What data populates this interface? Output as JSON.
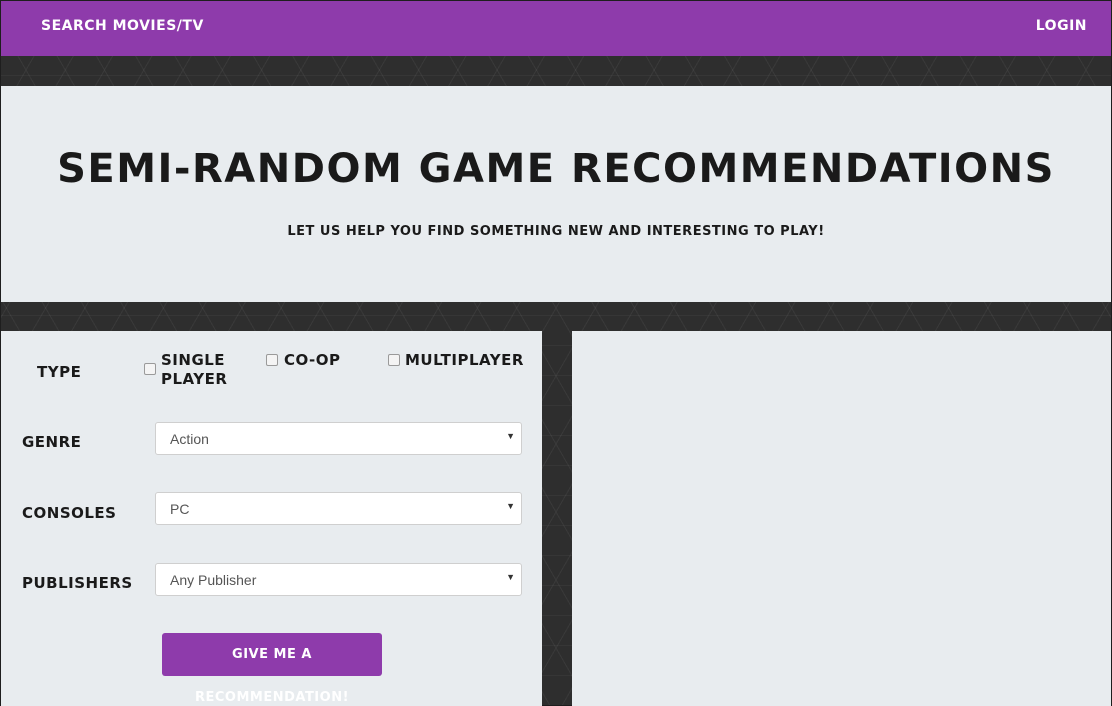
{
  "nav": {
    "search_label": "Search Movies/TV",
    "login_label": "Login"
  },
  "hero": {
    "title": "Semi-Random Game Recommendations",
    "subtitle": "Let us help you find something new and interesting to play!"
  },
  "form": {
    "type_label": "Type",
    "type_options": [
      {
        "label": "Single Player",
        "checked": false
      },
      {
        "label": "Co-Op",
        "checked": false
      },
      {
        "label": "Multiplayer",
        "checked": false
      }
    ],
    "genre_label": "Genre",
    "genre_value": "Action",
    "consoles_label": "Consoles",
    "consoles_value": "PC",
    "publishers_label": "Publishers",
    "publishers_value": "Any Publisher",
    "submit_label": "Give me a recommendation!"
  },
  "colors": {
    "accent": "#8e3bab",
    "panel": "#e8ecef",
    "background": "#2e2e2e"
  },
  "icons": {
    "dropdown": "chevron-down-icon"
  }
}
